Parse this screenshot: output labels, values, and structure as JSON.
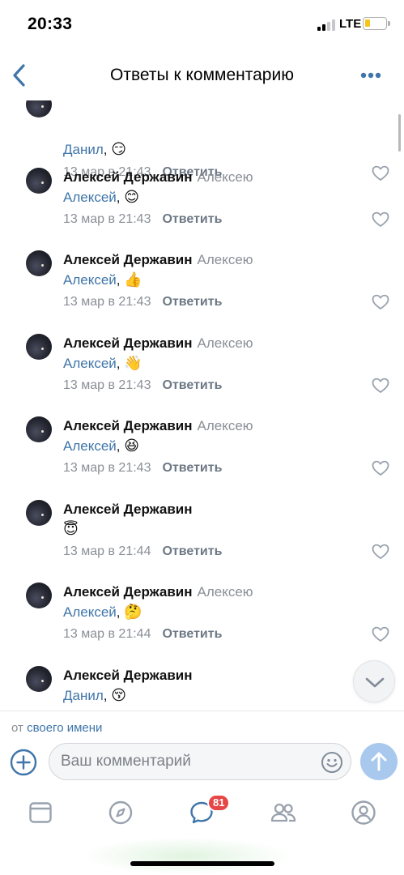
{
  "status_bar": {
    "time": "20:33",
    "network": "LTE"
  },
  "nav": {
    "title": "Ответы к комментарию",
    "back_icon": "chevron-left-icon",
    "more_icon": "more-dots-icon"
  },
  "comments": [
    {
      "author": "",
      "reply_to": "",
      "mention": "Данил",
      "sep": ",",
      "emoji": "😏",
      "date": "13 мар в 21:43",
      "reply_label": "Ответить"
    },
    {
      "author": "Алексей Державин",
      "reply_to": "Алексею",
      "mention": "Алексей",
      "sep": ",",
      "emoji": "😊",
      "date": "13 мар в 21:43",
      "reply_label": "Ответить"
    },
    {
      "author": "Алексей Державин",
      "reply_to": "Алексею",
      "mention": "Алексей",
      "sep": ",",
      "emoji": "👍",
      "date": "13 мар в 21:43",
      "reply_label": "Ответить"
    },
    {
      "author": "Алексей Державин",
      "reply_to": "Алексею",
      "mention": "Алексей",
      "sep": ",",
      "emoji": "👋",
      "date": "13 мар в 21:43",
      "reply_label": "Ответить"
    },
    {
      "author": "Алексей Державин",
      "reply_to": "Алексею",
      "mention": "Алексей",
      "sep": ",",
      "emoji": "😆",
      "date": "13 мар в 21:43",
      "reply_label": "Ответить"
    },
    {
      "author": "Алексей Державин",
      "reply_to": "",
      "mention": "",
      "sep": "",
      "emoji": "😇",
      "date": "13 мар в 21:44",
      "reply_label": "Ответить"
    },
    {
      "author": "Алексей Державин",
      "reply_to": "Алексею",
      "mention": "Алексей",
      "sep": ",",
      "emoji": "🤔",
      "date": "13 мар в 21:44",
      "reply_label": "Ответить"
    },
    {
      "author": "Алексей Державин",
      "reply_to": "",
      "mention": "Данил",
      "sep": ",",
      "emoji": "😚",
      "date": "",
      "reply_label": ""
    }
  ],
  "composer": {
    "from_prefix": "от",
    "from_link": "своего имени",
    "placeholder": "Ваш комментарий",
    "value": ""
  },
  "tabs": [
    {
      "name": "news",
      "icon": "newsfeed-icon"
    },
    {
      "name": "discover",
      "icon": "compass-icon"
    },
    {
      "name": "messages",
      "icon": "message-bubble-icon",
      "badge": "81"
    },
    {
      "name": "friends",
      "icon": "friends-icon"
    },
    {
      "name": "profile",
      "icon": "profile-icon"
    }
  ],
  "colors": {
    "accent": "#3f75a9",
    "icon": "#99a2ad",
    "badge": "#e64646",
    "send": "#a9c8ee"
  }
}
